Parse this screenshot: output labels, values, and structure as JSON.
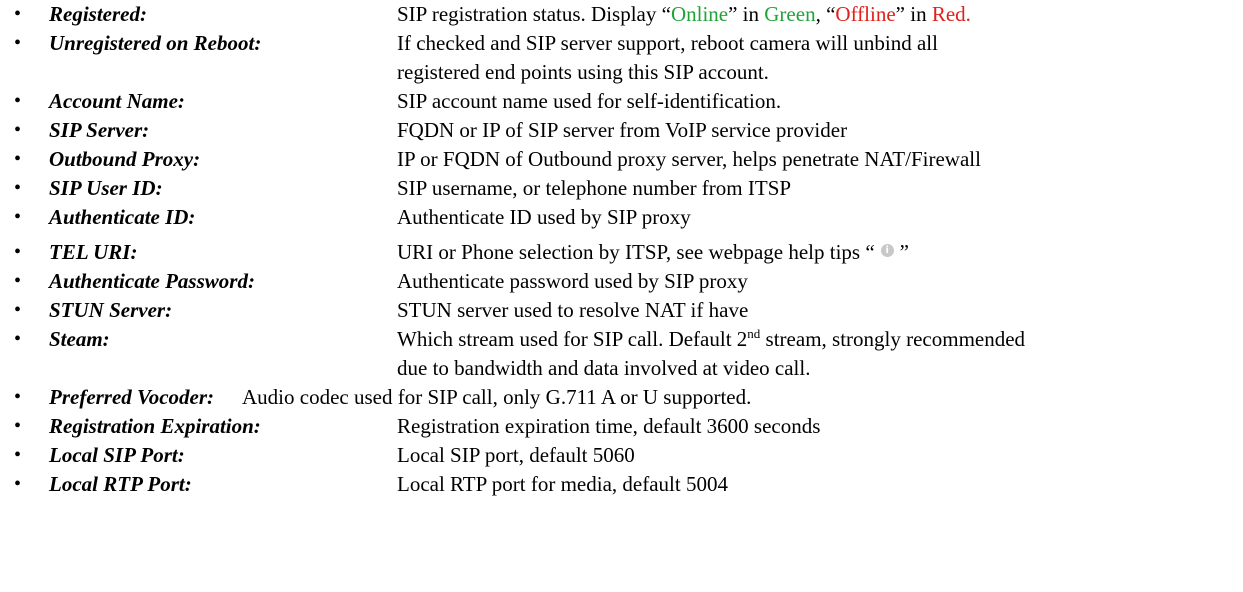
{
  "bullet": "•",
  "items": [
    {
      "term": "Registered:",
      "desc_parts": {
        "a": "SIP registration status. Display “",
        "online": "Online",
        "b": "” in ",
        "green": "Green",
        "c": ", “",
        "offline": "Offline",
        "d": "” in ",
        "red": "Red."
      }
    },
    {
      "term": "Unregistered on Reboot:",
      "desc_line1": "If checked and SIP server support, reboot camera will unbind all",
      "desc_line2": "registered end points using this SIP account."
    },
    {
      "term": "Account Name:",
      "desc": "SIP account name used for self-identification."
    },
    {
      "term": "SIP Server:",
      "desc": "FQDN or IP of SIP server from VoIP service provider"
    },
    {
      "term": "Outbound Proxy:",
      "desc": "IP or FQDN of Outbound proxy server, helps penetrate NAT/Firewall"
    },
    {
      "term": "SIP User ID:",
      "desc": "SIP username, or telephone number from ITSP"
    },
    {
      "term": "Authenticate ID:",
      "desc": "Authenticate ID used by SIP proxy"
    },
    {
      "term": "TEL URI:",
      "desc_before_icon": "URI or Phone selection by ITSP, see webpage help tips “",
      "desc_after_icon": "”",
      "icon": "info-icon"
    },
    {
      "term": "Authenticate Password:",
      "desc": "Authenticate password used by SIP proxy"
    },
    {
      "term": "STUN Server:",
      "desc": "STUN server used to resolve NAT if have"
    },
    {
      "term": "Steam:",
      "desc_a": "Which stream used for SIP call. Default 2",
      "desc_sup": "nd",
      "desc_b": " stream, strongly recommended",
      "desc_line2": "due to bandwidth and data involved at video call."
    },
    {
      "term": "Preferred Vocoder:",
      "desc": "Audio codec used for SIP call, only G.711 A or U supported."
    },
    {
      "term": "Registration Expiration:",
      "desc": "Registration expiration time, default 3600 seconds"
    },
    {
      "term": "Local SIP Port:",
      "desc": "Local SIP port, default 5060"
    },
    {
      "term": "Local RTP Port:",
      "desc": "Local RTP port for media, default 5004"
    }
  ],
  "colors": {
    "online": "#22a33a",
    "offline": "#e0201b"
  }
}
